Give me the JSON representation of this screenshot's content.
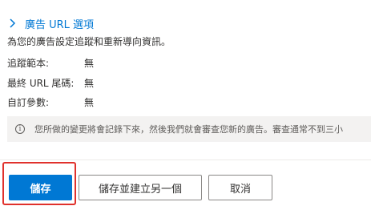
{
  "section": {
    "title": "廣告 URL 選項",
    "icon": "chevron-right-icon",
    "description": "為您的廣告設定追蹤和重新導向資訊。"
  },
  "fields": [
    {
      "label": "追蹤範本:",
      "value": "無"
    },
    {
      "label": "最終 URL 尾碼:",
      "value": "無"
    },
    {
      "label": "自訂參數:",
      "value": "無"
    }
  ],
  "info": {
    "icon": "info-icon",
    "text": "您所做的變更將會記錄下來，然後我們就會審查您新的廣告。審查通常不到三小"
  },
  "buttons": {
    "save": "儲存",
    "save_and_new": "儲存並建立另一個",
    "cancel": "取消"
  },
  "colors": {
    "accent": "#0078d4",
    "highlight": "#e0312c"
  }
}
